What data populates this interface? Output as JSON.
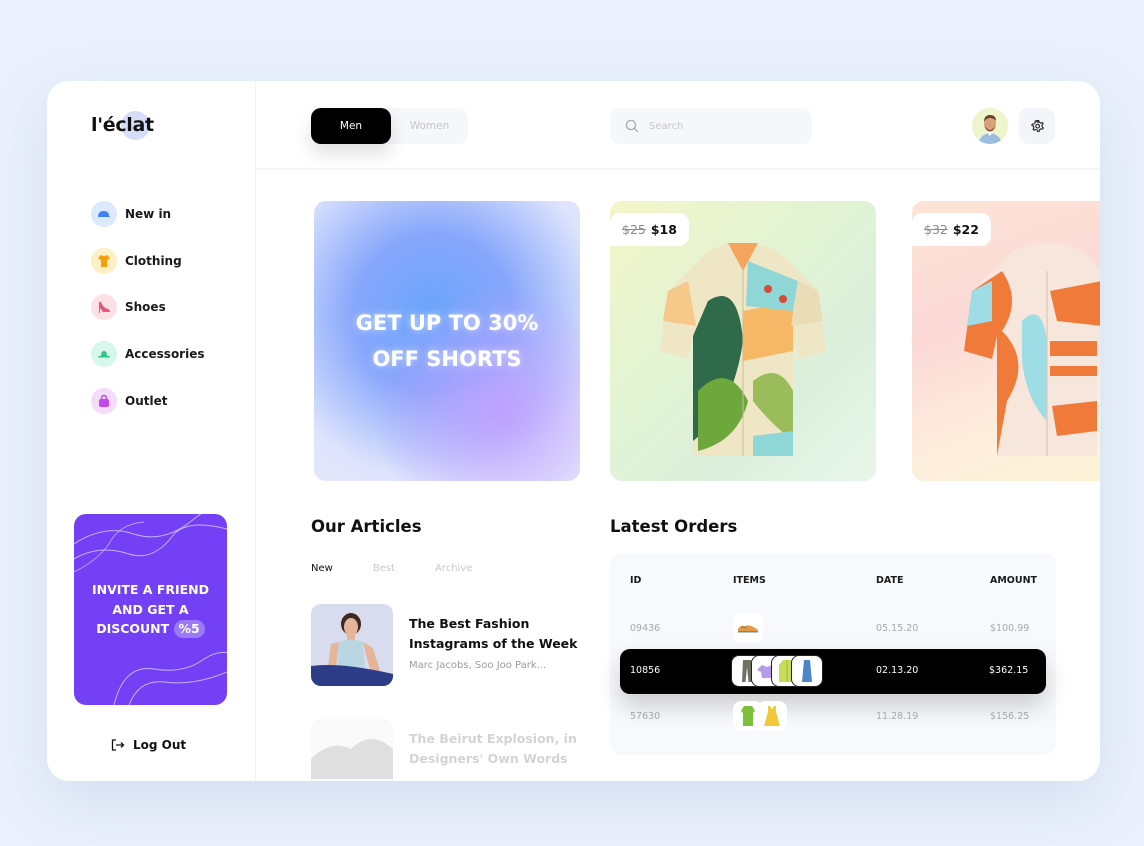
{
  "brand": {
    "name": "l'éclat"
  },
  "sidebar": {
    "items": [
      {
        "label": "New in",
        "icon": "cap-icon",
        "bg": "#dceafe",
        "color": "#3b82f6"
      },
      {
        "label": "Clothing",
        "icon": "tshirt-icon",
        "bg": "#fdf0c4",
        "color": "#f59e0b"
      },
      {
        "label": "Shoes",
        "icon": "heel-icon",
        "bg": "#fde0e6",
        "color": "#e7567c"
      },
      {
        "label": "Accessories",
        "icon": "hat-icon",
        "bg": "#d6f7ea",
        "color": "#34c48a"
      },
      {
        "label": "Outlet",
        "icon": "bag-icon",
        "bg": "#f6dcfb",
        "color": "#c14be8"
      }
    ],
    "promo": {
      "line1": "INVITE A FRIEND",
      "line2": "AND GET A",
      "line3": "DISCOUNT",
      "badge": "%5"
    },
    "logout_label": "Log Out"
  },
  "header": {
    "segments": {
      "active": "Men",
      "inactive": "Women"
    },
    "search": {
      "placeholder": "Search",
      "value": ""
    }
  },
  "banner": {
    "line1": "GET UP TO 30%",
    "line2": "OFF SHORTS"
  },
  "products": [
    {
      "old_price": "$25",
      "price": "$18"
    },
    {
      "old_price": "$32",
      "price": "$22"
    }
  ],
  "articles": {
    "title": "Our Articles",
    "tabs": [
      "New",
      "Best",
      "Archive"
    ],
    "active_tab": "New",
    "items": [
      {
        "title": "The Best Fashion Instagrams of the Week",
        "subtitle": "Marc Jacobs, Soo Joo Park..."
      },
      {
        "title": "The Beirut Explosion, in Designers' Own Words",
        "subtitle": ""
      }
    ]
  },
  "orders": {
    "title": "Latest Orders",
    "columns": [
      "ID",
      "ITEMS",
      "DATE",
      "AMOUNT"
    ],
    "rows": [
      {
        "id": "09436",
        "items": [
          "sneaker"
        ],
        "date": "05.15.20",
        "amount": "$100.99",
        "selected": false
      },
      {
        "id": "10856",
        "items": [
          "pants",
          "top",
          "jacket",
          "skirt"
        ],
        "date": "02.13.20",
        "amount": "$362.15",
        "selected": true
      },
      {
        "id": "57630",
        "items": [
          "shirt",
          "dress"
        ],
        "date": "11.28.19",
        "amount": "$156.25",
        "selected": false
      }
    ]
  }
}
